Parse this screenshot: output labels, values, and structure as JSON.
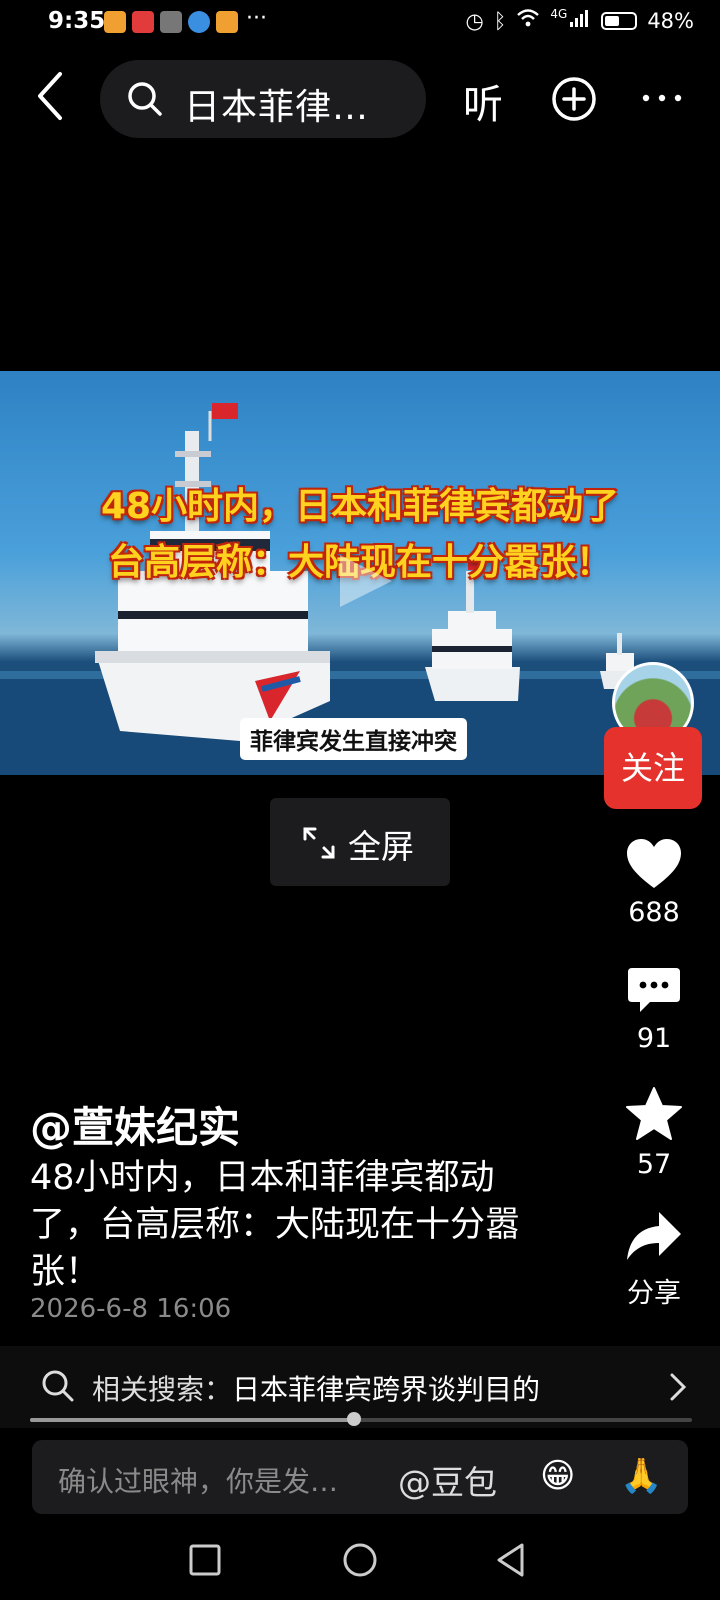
{
  "status": {
    "time": "9:35",
    "network": "4G",
    "battery": "48%",
    "battery_level": 0.48
  },
  "top_bar": {
    "search_text": "日本菲律…",
    "listen_label": "听"
  },
  "video": {
    "headline_line1": "48小时内，日本和菲律宾都动了",
    "headline_line2": "台高层称：大陆现在十分嚣张！",
    "subtitle": "菲律宾发生直接冲突",
    "fullscreen_label": "全屏"
  },
  "actions": {
    "follow_label": "关注",
    "likes": "688",
    "comments": "91",
    "favorites": "57",
    "share_label": "分享"
  },
  "post": {
    "author": "@萱妹纪实",
    "caption": "48小时内，日本和菲律宾都动了，台高层称：大陆现在十分嚣张！",
    "date": "2026-6-8 16:06"
  },
  "related": {
    "prefix": "相关搜索：",
    "query": "日本菲律宾跨界谈判目的"
  },
  "playback": {
    "progress": 0.49
  },
  "comment_bar": {
    "placeholder": "确认过眼神，你是发…",
    "mention": "@豆包",
    "emoji1": "😁",
    "emoji2": "🙏"
  },
  "colors": {
    "follow_bg": "#e5322d",
    "headline_text": "#ffd21f",
    "headline_stroke": "#c0240a"
  },
  "icons": [
    "back-icon",
    "search-icon",
    "add-circle-icon",
    "more-icon",
    "play-icon",
    "heart-icon",
    "comment-icon",
    "star-icon",
    "share-icon",
    "fullscreen-icon",
    "chevron-right-icon",
    "recent-apps-icon",
    "home-icon",
    "back-nav-icon"
  ]
}
